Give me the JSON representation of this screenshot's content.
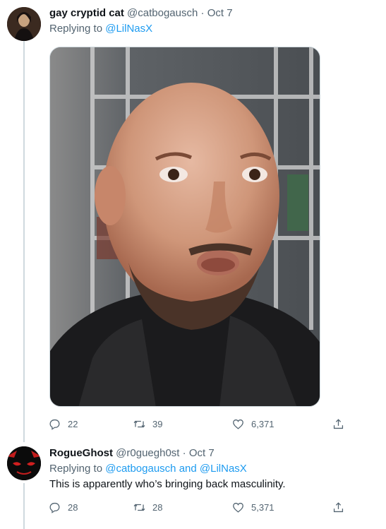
{
  "tweets": [
    {
      "author": {
        "name": "gay cryptid cat",
        "handle": "@catbogausch"
      },
      "date": "Oct 7",
      "replying_prefix": "Replying to",
      "replying_to": [
        "@LilNasX"
      ],
      "actions": {
        "replies": "22",
        "retweets": "39",
        "likes": "6,371"
      }
    },
    {
      "author": {
        "name": "RogueGhost",
        "handle": "@r0guegh0st"
      },
      "date": "Oct 7",
      "replying_prefix": "Replying to",
      "replying_to": [
        "@catbogausch",
        "@LilNasX"
      ],
      "replying_joiner": "and",
      "text": "This is apparently who’s bringing back masculinity.",
      "actions": {
        "replies": "28",
        "retweets": "28",
        "likes": "5,371"
      }
    }
  ],
  "colors": {
    "link": "#1d9bf0",
    "muted": "#536471",
    "divider": "#cfd9de"
  },
  "icons": [
    "reply-icon",
    "retweet-icon",
    "like-icon",
    "share-icon"
  ]
}
